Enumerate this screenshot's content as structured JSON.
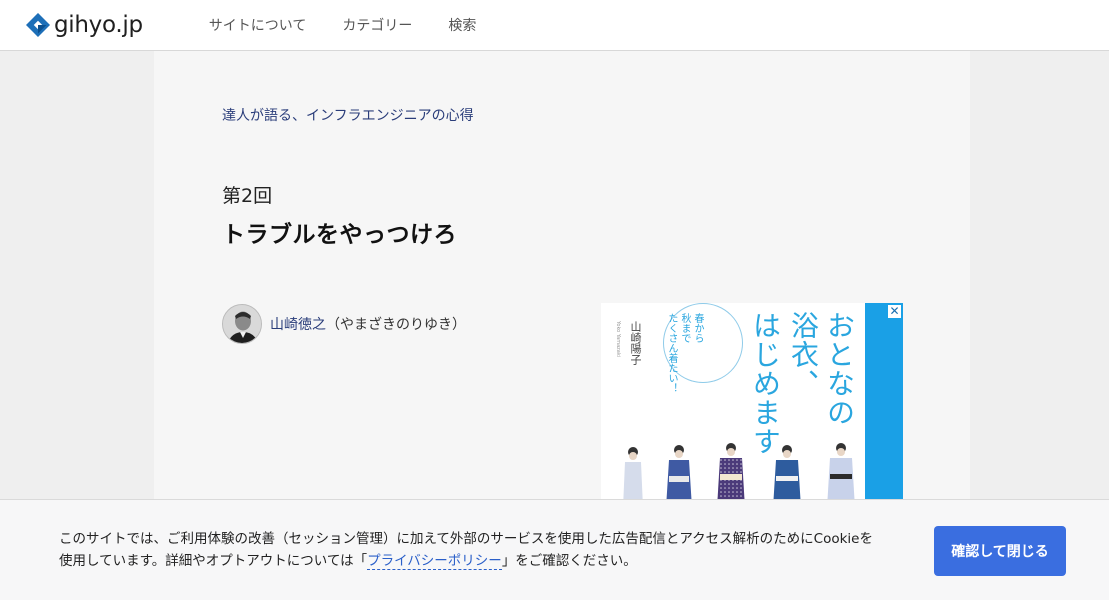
{
  "header": {
    "logo_text": "gihyo.jp",
    "nav": [
      {
        "label": "サイトについて"
      },
      {
        "label": "カテゴリー"
      },
      {
        "label": "検索"
      }
    ]
  },
  "article": {
    "series": "達人が語る、インフラエンジニアの心得",
    "episode": "第2回",
    "title": "トラブルをやっつけろ",
    "author": {
      "name": "山崎徳之",
      "kana": "（やまざきのりゆき）"
    }
  },
  "ad": {
    "close": "✕",
    "headline_col1": "おとなの",
    "headline_col2": "浴衣、",
    "headline_col3": "はじめます",
    "sub_col1": "春から",
    "sub_col2": "秋まで",
    "sub_col3": "たくさん着たい！",
    "author": "山崎陽子",
    "author_en": "Yoko Yamazaki"
  },
  "cookie": {
    "line1": "このサイトでは、ご利用体験の改善（セッション管理）に加えて外部のサービスを使用した広告配信とアクセス解析のためにCookieを",
    "line2_before": "使用しています。詳細やオプトアウトについては「",
    "policy_link": "プライバシーポリシー",
    "line2_after": "」をご確認ください。",
    "button": "確認して閉じる"
  },
  "colors": {
    "link": "#2a3d7a",
    "button": "#3a6ee0",
    "ad_accent": "#1aa0e6"
  }
}
